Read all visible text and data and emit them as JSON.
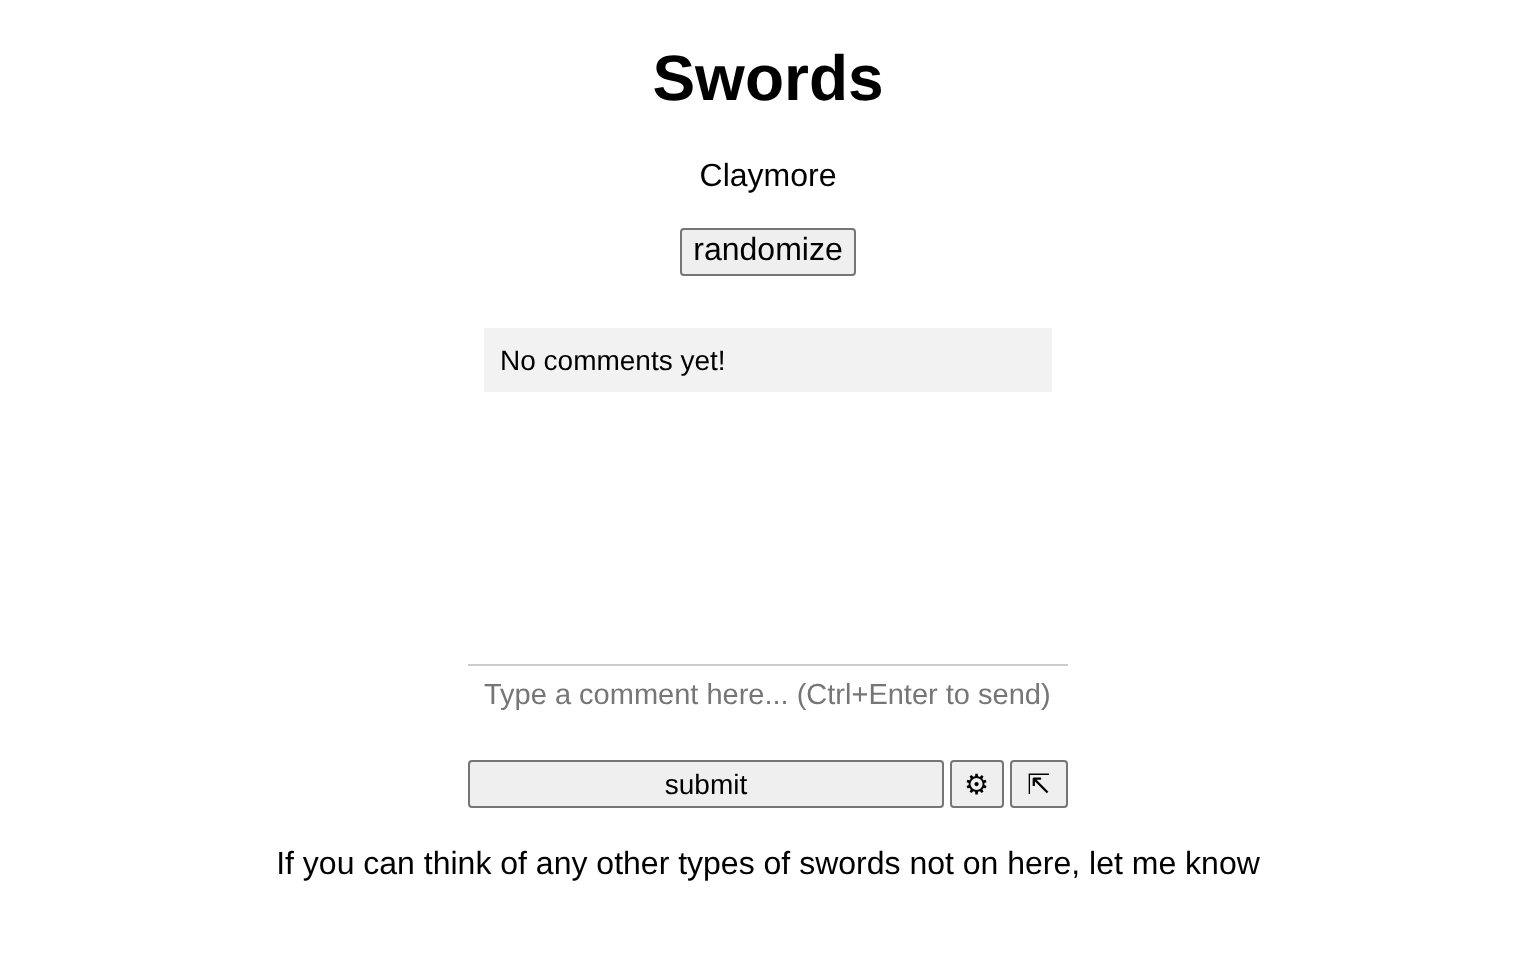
{
  "title": "Swords",
  "current": "Claymore",
  "randomize_button": "randomize",
  "comments": {
    "empty_text": "No comments yet!"
  },
  "comment_field": {
    "placeholder": "Type a comment here... (Ctrl+Enter to send)"
  },
  "submit_button": "submit",
  "settings_button": "⚙",
  "popout_button": "⇱",
  "footer": "If you can think of any other types of swords not on here, let me know"
}
